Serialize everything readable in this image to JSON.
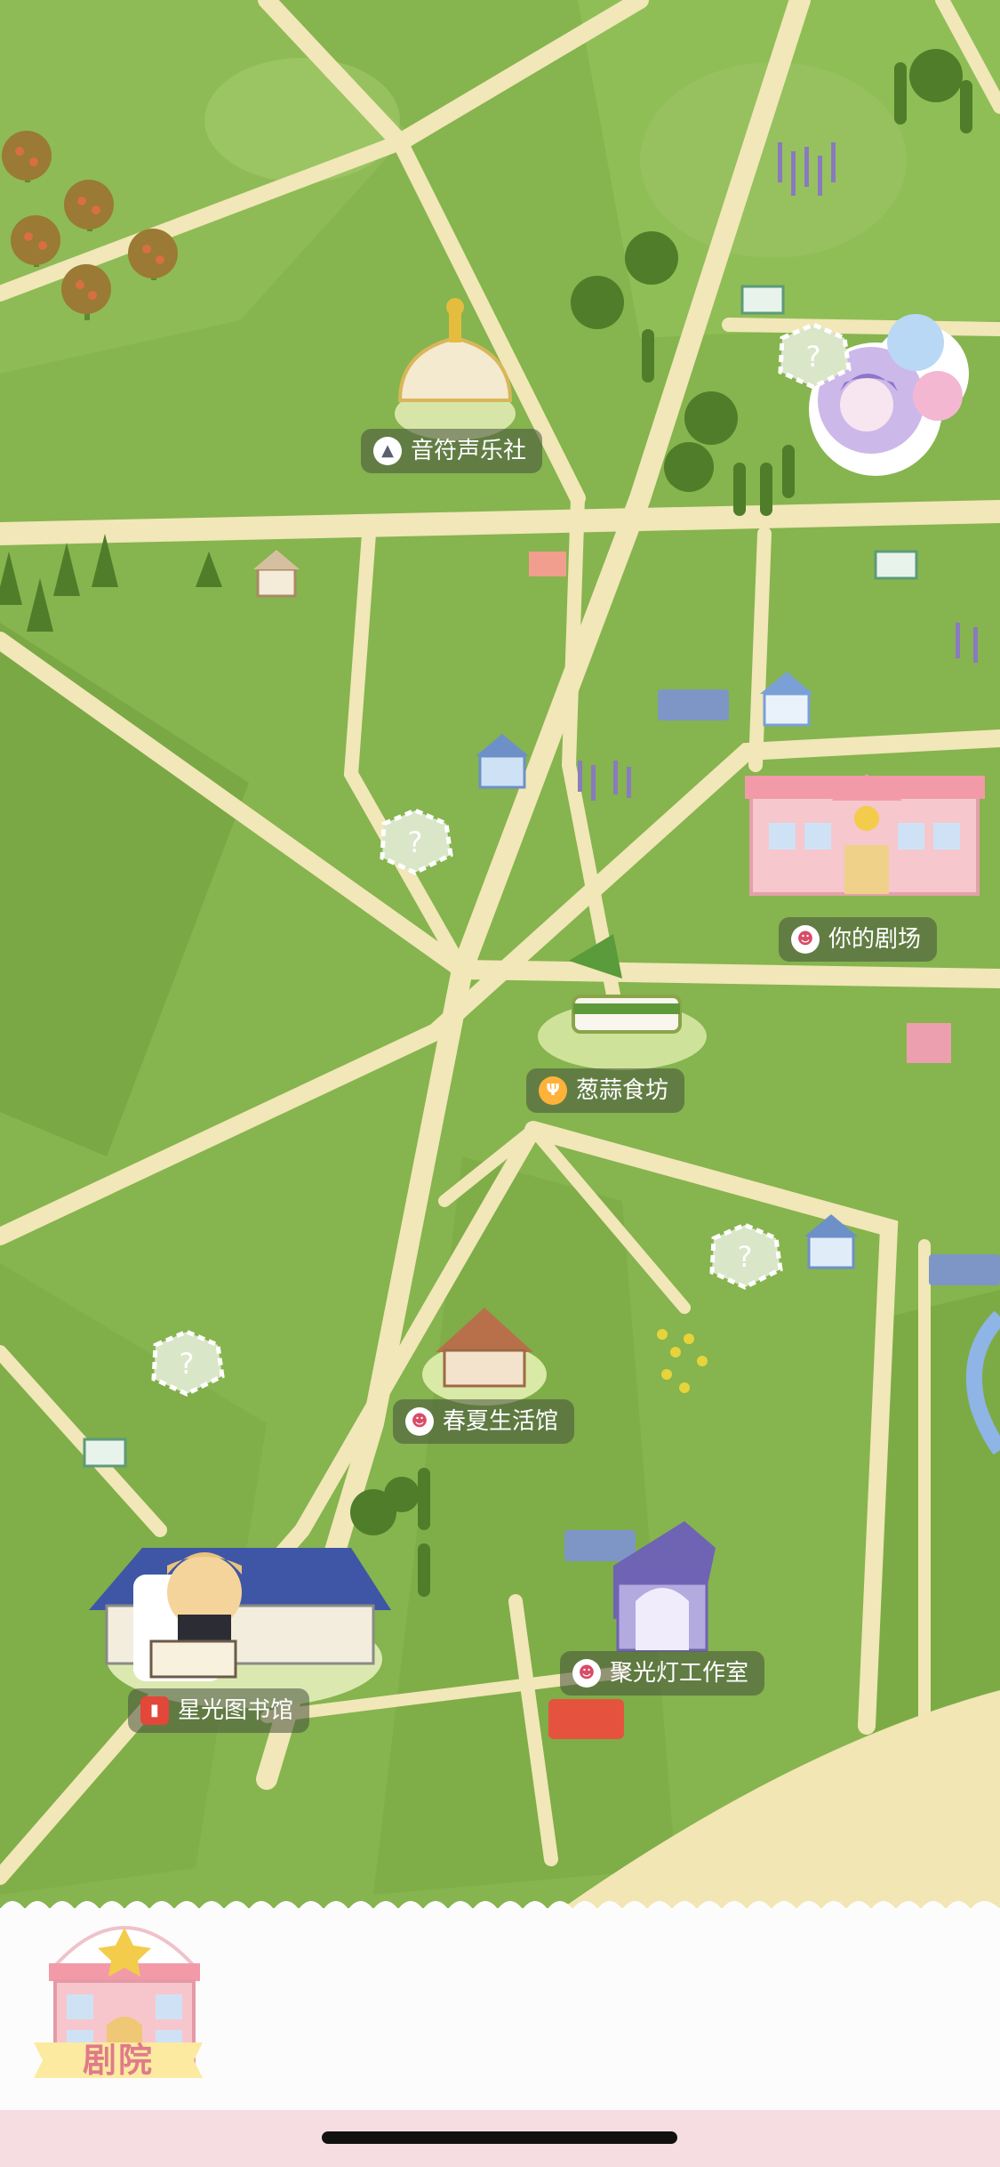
{
  "map": {
    "locations": [
      {
        "id": "music-club",
        "label": "音符声乐社",
        "icon": "graduation-cap-icon"
      },
      {
        "id": "your-theater",
        "label": "你的剧场",
        "icon": "theater-masks-icon"
      },
      {
        "id": "garlic-kitchen",
        "label": "葱蒜食坊",
        "icon": "fork-knife-icon"
      },
      {
        "id": "spring-summer-hall",
        "label": "春夏生活馆",
        "icon": "theater-masks-icon"
      },
      {
        "id": "spotlight-studio",
        "label": "聚光灯工作室",
        "icon": "theater-masks-icon"
      },
      {
        "id": "starlight-library",
        "label": "星光图书馆",
        "icon": "book-icon"
      }
    ],
    "unknown_marker": "?",
    "colors": {
      "grass": "#86b44e",
      "road": "#f1e7b8",
      "label_bg": "#4a5040"
    }
  },
  "bottom_bar": {
    "theater_button_label": "剧院",
    "accent": "#e07a8a"
  }
}
